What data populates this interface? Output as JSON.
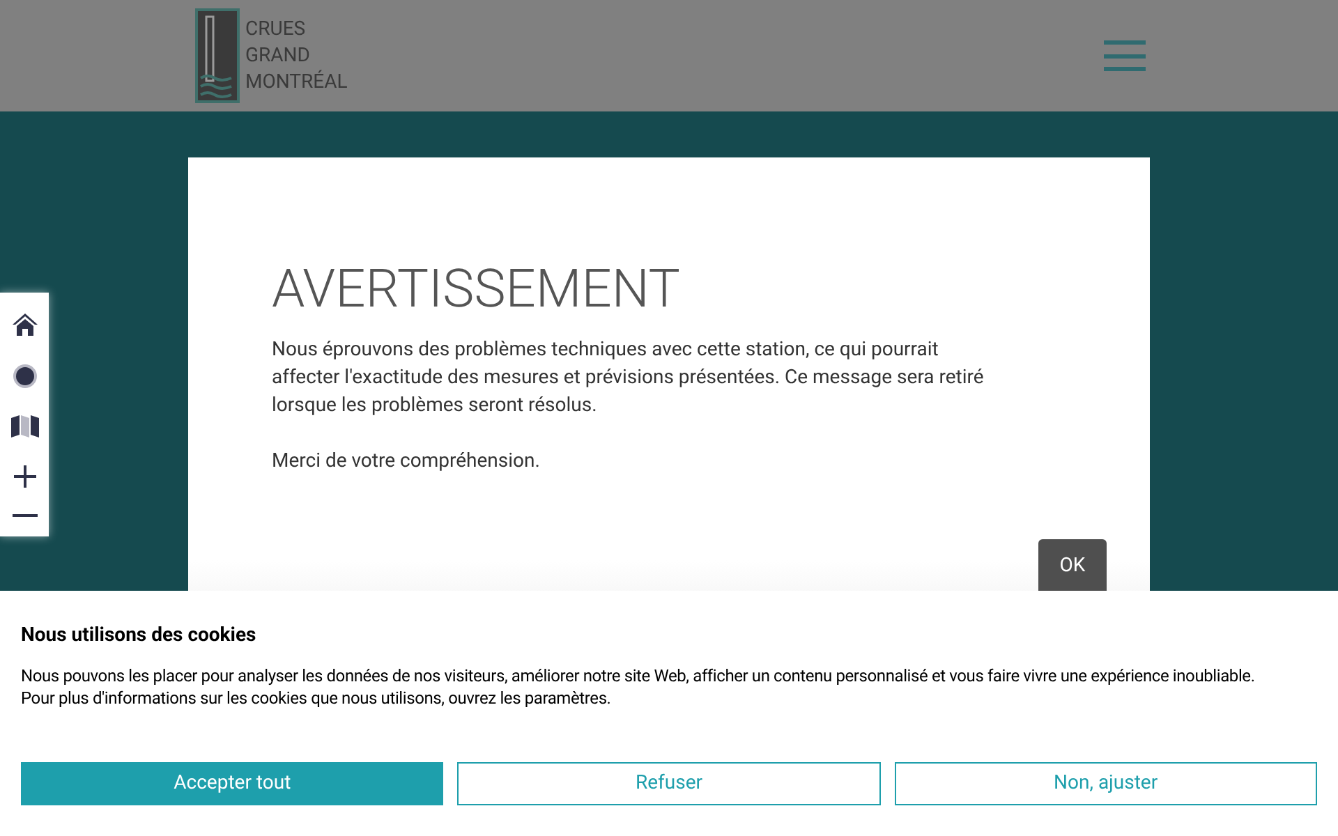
{
  "header": {
    "logo_lines": [
      "CRUES",
      "GRAND",
      "MONTRÉAL"
    ]
  },
  "map_controls": [
    {
      "kind": "home"
    },
    {
      "kind": "locate"
    },
    {
      "kind": "layers"
    },
    {
      "kind": "zoom-in"
    },
    {
      "kind": "zoom-out"
    }
  ],
  "dialog": {
    "title": "AVERTISSEMENT",
    "paragraphs": [
      "Nous éprouvons des problèmes techniques avec cette station, ce qui pourrait affecter l'exactitude des mesures et prévisions présentées. Ce message sera retiré lorsque les problèmes seront résolus.",
      "Merci de votre compréhension."
    ],
    "button": "OK"
  },
  "cookie_banner": {
    "title": "Nous utilisons des cookies",
    "lines": [
      "Nous pouvons les placer pour analyser les données de nos visiteurs, améliorer notre site Web, afficher un contenu personnalisé et vous faire vivre une expérience inoubliable.",
      "Pour plus d'informations sur les cookies que nous utilisons, ouvrez les paramètres."
    ],
    "buttons": [
      {
        "label": "Accepter tout",
        "kind": "primary"
      },
      {
        "label": "Refuser",
        "kind": "outline"
      },
      {
        "label": "Non, ajuster",
        "kind": "outline"
      }
    ]
  }
}
